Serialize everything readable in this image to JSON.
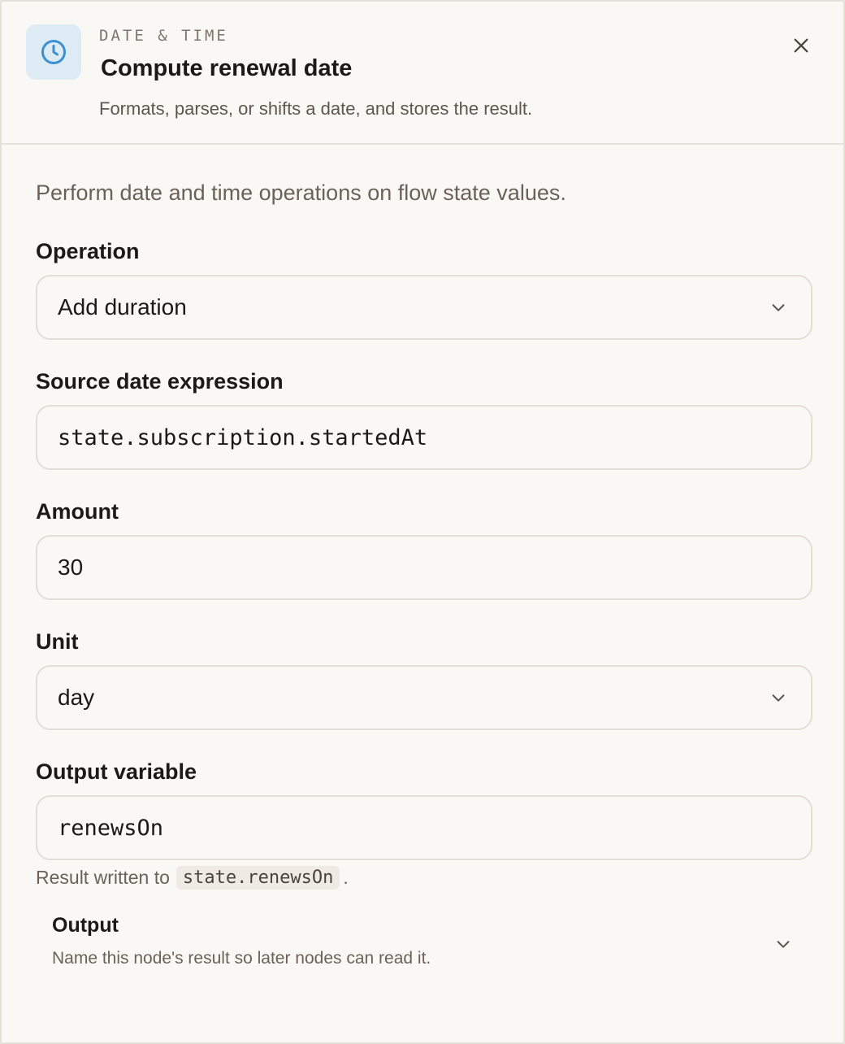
{
  "header": {
    "category": "DATE & TIME",
    "title": "Compute renewal date",
    "subtitle": "Formats, parses, or shifts a date, and stores the result.",
    "icon": "clock-icon",
    "accent_color": "#3d8fd0"
  },
  "form": {
    "description": "Perform date and time operations on flow state values.",
    "operation": {
      "label": "Operation",
      "value": "Add duration"
    },
    "source": {
      "label": "Source date expression",
      "value": "state.subscription.startedAt"
    },
    "amount": {
      "label": "Amount",
      "value": "30"
    },
    "unit": {
      "label": "Unit",
      "value": "day"
    },
    "output_variable": {
      "label": "Output variable",
      "value": "renewsOn",
      "help_prefix": "Result written to",
      "help_code": "state.renewsOn",
      "help_suffix": "."
    }
  },
  "output_section": {
    "title": "Output",
    "description": "Name this node's result so later nodes can read it."
  }
}
